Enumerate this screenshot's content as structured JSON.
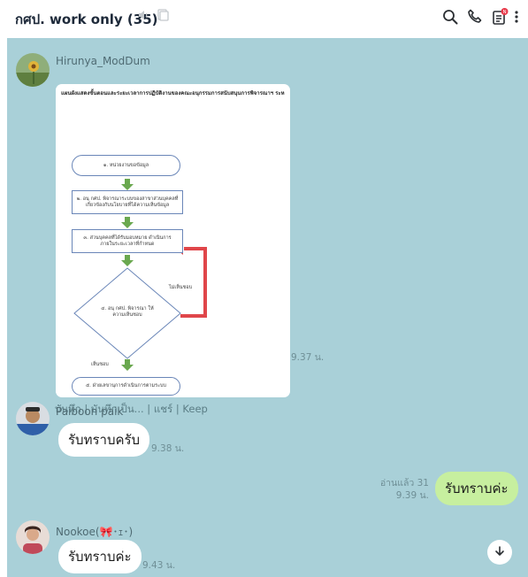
{
  "header": {
    "title": "กศป. work only (35)",
    "icons": [
      "mute-icon",
      "note-icon",
      "search-icon",
      "call-icon",
      "notes-badge-icon",
      "more-icon"
    ]
  },
  "colors": {
    "chat_bg": "#a9d0d8",
    "my_bubble": "#c7ef9f",
    "other_bubble": "#ffffff",
    "flow_arrow": "#6aa84f",
    "flow_loop": "#e0464a"
  },
  "messages": [
    {
      "sender": "Hirunya_ModDum",
      "type": "image",
      "time": "9.37 น.",
      "image": {
        "title": "แผนผังแสดงขั้นตอนและระยะเวลาการปฏิบัติงานของคณะอนุกรรมการสนับสนุนการพิจารณาฯ ระหว่างประเทศ",
        "steps": [
          "๑. หน่วยงานขอข้อมูล",
          "๒. อนุ กศป. พิจารณาระบบของสาขาส่วนบุคคลที่ เกี่ยวข้องกับนโยบายที่ได้ความเห็นข้อมูล",
          "๓. ส่วนบุคคลที่ได้รับมอบหมาย ดำเนินการ ภายในระยะเวลาที่กำหนด",
          "๔. อนุ กศป. พิจารณา ให้ความเห็นชอบ",
          "๕. ฝ่ายเลขานุการดำเนินการตามระบบ"
        ],
        "no_label": "ไม่เห็นชอบ",
        "yes_label": "เห็นชอบ"
      },
      "actions": "บันทึก | บันทึกเป็น... | แชร์ | Keep"
    },
    {
      "sender": "Paiboon paik",
      "type": "text",
      "text": "รับทราบครับ",
      "time": "9.38 น."
    },
    {
      "sender": "me",
      "type": "text",
      "text": "รับทราบค่ะ",
      "read": "อ่านแล้ว 31",
      "time": "9.39 น."
    },
    {
      "sender": "Nookoe(🎀･ｪ･)",
      "type": "text",
      "text": "รับทราบค่ะ",
      "time": "9.43 น."
    }
  ]
}
